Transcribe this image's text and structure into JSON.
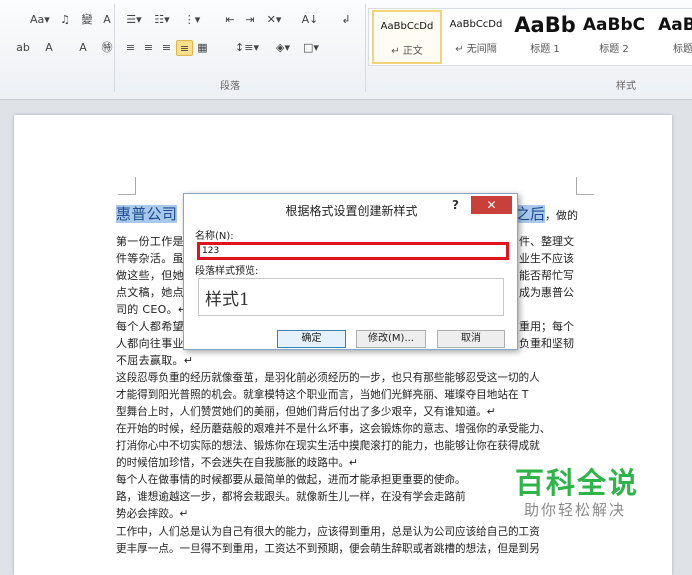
{
  "ribbon": {
    "font_row1": [
      "Aa▾",
      "♫",
      "變",
      "A"
    ],
    "font_row2": [
      "ab",
      "A",
      "A",
      "㊕"
    ],
    "para_row1": [
      "☰▾",
      "☷▾",
      "⋮▾",
      "⇤",
      "⇥",
      "✕▾",
      "A↓",
      "↲"
    ],
    "para_row2": [
      "≡",
      "≡",
      "≡",
      "≡",
      "▦",
      "↕≡▾",
      "◈▾",
      "□▾"
    ],
    "group_paragraph": "段落",
    "group_styles": "样式",
    "styles": [
      {
        "preview": "AaBbCcDd",
        "name": "↵ 正文",
        "selected": true
      },
      {
        "preview": "AaBbCcDd",
        "name": "↵ 无间隔"
      },
      {
        "preview": "AaBb",
        "name": "标题 1"
      },
      {
        "preview": "AaBbC",
        "name": "标题 2"
      },
      {
        "preview": "AaBb",
        "name": "标题"
      }
    ]
  },
  "document": {
    "heading_left": "惠普公司",
    "heading_right": "之后",
    "heading_tail": "，做的",
    "lines_partial": [
      {
        "left": "第一份工作是",
        "right": "件、整理文"
      },
      {
        "left": "件等杂活。虽",
        "right": "业生不应该"
      },
      {
        "left": "做这些，但她",
        "right": "能否帮忙写"
      },
      {
        "left": "点文稿，她点",
        "right": "成为惠普公"
      },
      {
        "left": "司的 CEO。↵",
        "right": ""
      },
      {
        "left": "每个人都希望",
        "right": "重用；每个"
      },
      {
        "left": "人都向往事业",
        "right": "负重和坚韧"
      },
      {
        "left": "不屈去赢取。↵",
        "right": ""
      }
    ],
    "lines": [
      "这段忍辱负重的经历就像蚕茧，是羽化前必须经历的一步，也只有那些能够忍受这一切的人",
      "才能得到阳光普照的机会。就拿模特这个职业而言，当她们光鲜亮丽、璀璨夺目地站在 T",
      "型舞台上时，人们赞赏她们的美丽，但她们背后付出了多少艰辛，又有谁知道。↵",
      "在开始的时候，经历蘑菇般的艰难并不是什么坏事，这会锻炼你的意志、增强你的承受能力、",
      "打消你心中不切实际的想法、锻炼你在现实生活中摸爬滚打的能力，也能够让你在获得成就",
      "的时候倍加珍惜，不会迷失在自我膨胀的歧路中。↵",
      "每个人在做事情的时候都要从最简单的做起，进而才能承担更重要的使命。",
      "路，谁想逾越这一步，都将会栽跟头。就像新生儿一样，在没有学会走路前",
      "势必会摔跤。↵",
      "工作中，人们总是认为自己有很大的能力，应该得到重用，总是认为公司应该给自己的工资",
      "更丰厚一点。一旦得不到重用，工资达不到预期，便会萌生辞职或者跳槽的想法，但是到另"
    ]
  },
  "dialog": {
    "title": "根据格式设置创建新样式",
    "help": "?",
    "close": "✕",
    "name_label": "名称(N):",
    "name_value": "123",
    "preview_label": "段落样式预览:",
    "preview_text": "样式1",
    "ok": "确定",
    "modify": "修改(M)...",
    "cancel": "取消"
  },
  "watermark": {
    "title": "百科全说",
    "subtitle": "助你轻松解决"
  },
  "colors": {
    "highlight": "#a8c8ec",
    "close": "#c9403a",
    "input_border": "#e0141d",
    "watermark": "#2fb44a"
  }
}
